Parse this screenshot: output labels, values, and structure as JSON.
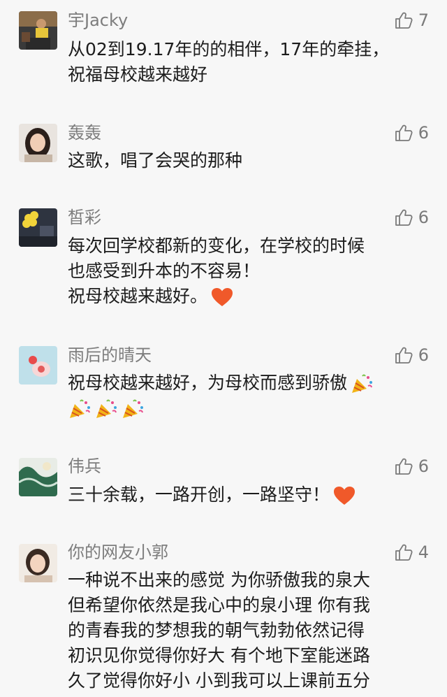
{
  "comments": [
    {
      "name": "宇Jacky",
      "likes": "7",
      "lines": [
        "从02到19.17年的的相伴，17年的牵挂，",
        "祝福母校越来越好"
      ],
      "avatar_icon": "man-portrait-avatar"
    },
    {
      "name": "轰轰",
      "likes": "6",
      "lines": [
        "这歌，唱了会哭的那种"
      ],
      "avatar_icon": "woman-portrait-avatar"
    },
    {
      "name": "皙彩",
      "likes": "6",
      "lines": [
        "每次回学校都新的变化，在学校的时候",
        "也感受到升本的不容易！",
        "祝母校越来越好。"
      ],
      "trailing_emoji": "heart",
      "avatar_icon": "yellow-flower-avatar"
    },
    {
      "name": "雨后的晴天",
      "likes": "6",
      "lines": [
        "祝母校越来越好，为母校而感到骄傲"
      ],
      "trailing_emoji": "party-popper",
      "extra_popper_line": 3,
      "avatar_icon": "strawberry-drink-avatar"
    },
    {
      "name": "伟兵",
      "likes": "6",
      "lines": [
        "三十余载，一路开创，一路坚守！"
      ],
      "trailing_emoji": "heart",
      "avatar_icon": "green-pattern-avatar"
    },
    {
      "name": "你的网友小郭",
      "likes": "4",
      "lines": [
        "一种说不出来的感觉 为你骄傲我的泉大",
        "但希望你依然是我心中的泉小理 你有我",
        "的青春我的梦想我的朝气勃勃依然记得",
        "初识见你觉得你好大 有个地下室能迷路",
        "久了觉得你好小 小到我可以上课前五分"
      ],
      "avatar_icon": "girl-portrait-avatar"
    }
  ],
  "colors": {
    "background": "#f7f7f7",
    "name": "#7d7d7d",
    "text": "#1c1c1c",
    "heart": "#f0592a"
  }
}
